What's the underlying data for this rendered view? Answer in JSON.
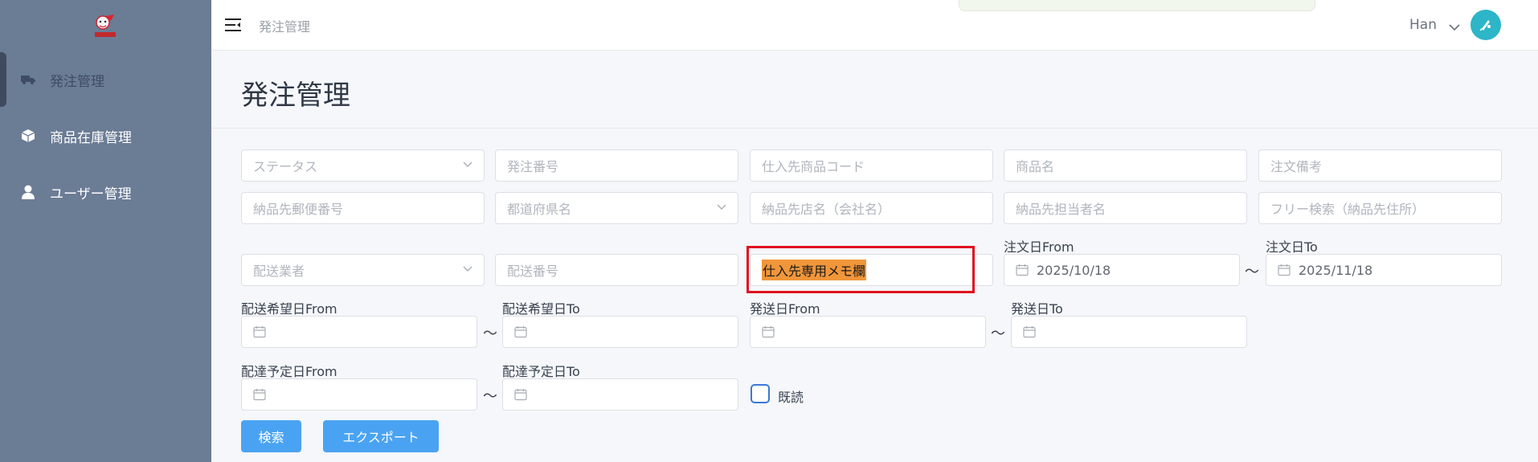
{
  "sidebar": {
    "items": [
      {
        "label": "発注管理",
        "icon": "truck-icon"
      },
      {
        "label": "商品在庫管理",
        "icon": "box-icon"
      },
      {
        "label": "ユーザー管理",
        "icon": "user-icon"
      }
    ]
  },
  "header": {
    "breadcrumb": "発注管理",
    "user_name": "Han"
  },
  "main": {
    "page_title": "発注管理"
  },
  "filters": {
    "status_placeholder": "ステータス",
    "order_number_placeholder": "発注番号",
    "supplier_code_placeholder": "仕入先商品コード",
    "product_name_placeholder": "商品名",
    "order_note_placeholder": "注文備考",
    "postal_code_placeholder": "納品先郵便番号",
    "prefecture_placeholder": "都道府県名",
    "store_name_placeholder": "納品先店名（会社名）",
    "contact_name_placeholder": "納品先担当者名",
    "free_search_placeholder": "フリー検索（納品先住所）",
    "carrier_placeholder": "配送業者",
    "delivery_number_placeholder": "配送番号",
    "supplier_memo_value": "仕入先専用メモ欄",
    "order_date_from_label": "注文日From",
    "order_date_from_value": "2025/10/18",
    "order_date_to_label": "注文日To",
    "order_date_to_value": "2025/11/18",
    "desired_date_from_label": "配送希望日From",
    "desired_date_to_label": "配送希望日To",
    "ship_date_from_label": "発送日From",
    "ship_date_to_label": "発送日To",
    "scheduled_date_from_label": "配達予定日From",
    "scheduled_date_to_label": "配達予定日To",
    "tilde": "〜",
    "read_label": "既読"
  },
  "actions": {
    "search_label": "検索",
    "export_label": "エクスポート"
  },
  "colors": {
    "sidebar_bg": "#6b7c95",
    "primary_button": "#4aa3f2",
    "highlight_border": "#e0101e",
    "memo_highlight": "#f0963a",
    "avatar_bg": "#2cb6c7"
  }
}
